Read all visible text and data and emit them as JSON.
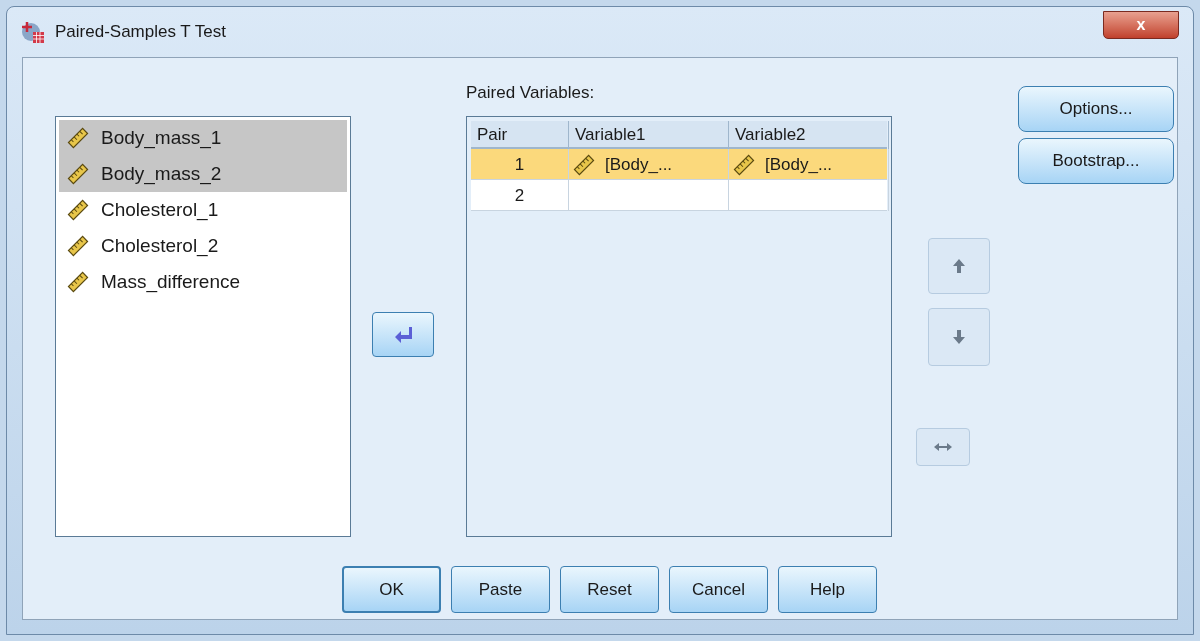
{
  "window": {
    "title": "Paired-Samples T Test",
    "close": "x"
  },
  "source_list": [
    {
      "name": "Body_mass_1",
      "selected": true
    },
    {
      "name": "Body_mass_2",
      "selected": true
    },
    {
      "name": "Cholesterol_1",
      "selected": false
    },
    {
      "name": "Cholesterol_2",
      "selected": false
    },
    {
      "name": "Mass_difference",
      "selected": false
    }
  ],
  "move_button": {
    "kind": "move",
    "disabled": false
  },
  "paired_variables": {
    "label": "Paired Variables:",
    "columns": [
      "Pair",
      "Variable1",
      "Variable2"
    ],
    "rows": [
      {
        "pair": "1",
        "variable1": "[Body_...",
        "variable2": "[Body_...",
        "selected": true
      },
      {
        "pair": "2",
        "selected": false
      }
    ]
  },
  "order_buttons": [
    {
      "kind": "up",
      "disabled": true
    },
    {
      "kind": "down",
      "disabled": true
    },
    {
      "kind": "swap",
      "disabled": true
    }
  ],
  "side_buttons": [
    "Options...",
    "Bootstrap..."
  ],
  "buttons": [
    {
      "label": "OK",
      "default": true
    },
    {
      "label": "Paste",
      "default": false
    },
    {
      "label": "Reset",
      "default": false
    },
    {
      "label": "Cancel",
      "default": false
    },
    {
      "label": "Help",
      "default": false
    }
  ]
}
